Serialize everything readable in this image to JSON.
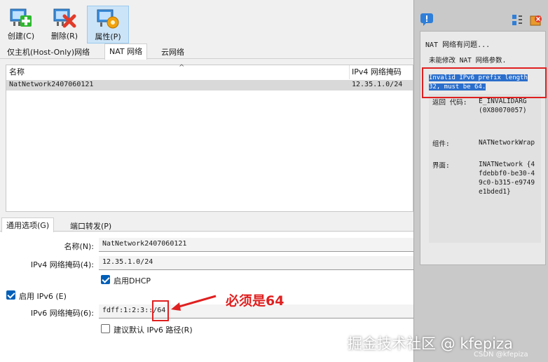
{
  "toolbar": {
    "create_label": "创建(C)",
    "delete_label": "删除(R)",
    "properties_label": "属性(P)"
  },
  "top_tabs": [
    "仅主机(Host-Only)网络",
    "NAT 网络",
    "云网络"
  ],
  "table": {
    "columns": [
      "名称",
      "IPv4 网络掩码"
    ],
    "rows": [
      {
        "name": "NatNetwork2407060121",
        "ipv4": "12.35.1.0/24"
      }
    ]
  },
  "bottom_tabs": [
    "通用选项(G)",
    "端口转发(P)"
  ],
  "form": {
    "name_label": "名称(N):",
    "name_value": "NatNetwork2407060121",
    "ipv4_label": "IPv4 网络掩码(4):",
    "ipv4_value": "12.35.1.0/24",
    "dhcp_label": "启用DHCP",
    "dhcp_checked": true,
    "ipv6_enable_label": "启用 IPv6 (E)",
    "ipv6_enable_checked": true,
    "ipv6_label": "IPv6 网络掩码(6):",
    "ipv6_value": "fdff:1:2:3::/64",
    "default_route_label": "建议默认 IPv6 路径(R)",
    "default_route_checked": false
  },
  "annotation": {
    "text": "必须是64",
    "color": "#e02020"
  },
  "error_panel": {
    "title": "NAT 网络有问题...",
    "subtitle": "未能修改 NAT 网络参数.",
    "message": "Invalid IPv6 prefix length 32, must be 64.",
    "details": [
      {
        "key": "返回 代码:",
        "value": "E_INVALIDARG (0X80070057)"
      },
      {
        "key": "组件:",
        "value": "NATNetworkWrap"
      },
      {
        "key": "界面:",
        "value": "INATNetwork {4fdebbf0-be30-49c0-b315-e9749e1bded1}"
      }
    ]
  },
  "watermark": {
    "main": "掘金技术社区 @ kfepiza",
    "small": "CSDN @kfepiza"
  },
  "colors": {
    "accent": "#005fb8",
    "highlight": "#2b6ecb",
    "annotation_red": "#e02020",
    "panel_bg": "#c9c9c9"
  }
}
